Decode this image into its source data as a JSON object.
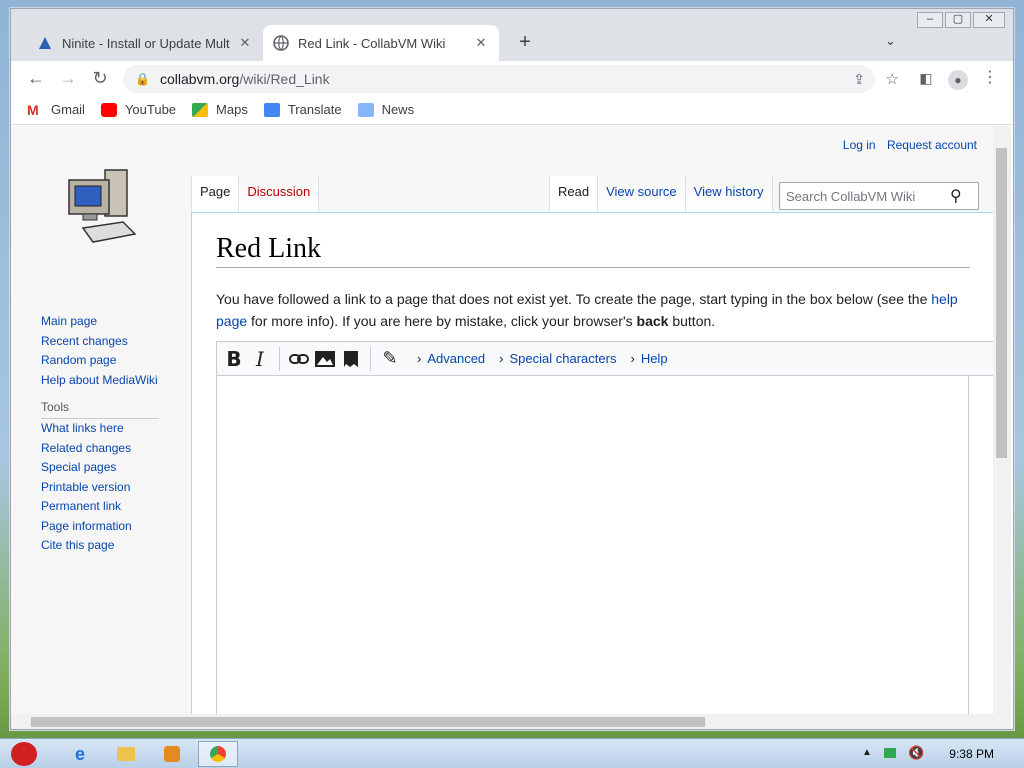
{
  "browser": {
    "tabs": [
      {
        "title": "Ninite - Install or Update Mult"
      },
      {
        "title": "Red Link - CollabVM Wiki"
      }
    ],
    "url_host": "collabvm.org",
    "url_path": "/wiki/Red_Link",
    "bookmarks": [
      "Gmail",
      "YouTube",
      "Maps",
      "Translate",
      "News"
    ]
  },
  "wiki": {
    "top_links": [
      "Log in",
      "Request account"
    ],
    "left_tabs": [
      "Page",
      "Discussion"
    ],
    "right_tabs": [
      "Read",
      "View source",
      "View history"
    ],
    "search_placeholder": "Search CollabVM Wiki",
    "title": "Red Link",
    "intro": {
      "part1": "You have followed a link to a page that does not exist yet. To create the page, start typing in the box below (see the ",
      "help_link": "help page",
      "part2": " for more info). If you are here by mistake, click your browser's ",
      "bold": "back",
      "part3": " button."
    },
    "nav_links": [
      "Main page",
      "Recent changes",
      "Random page",
      "Help about MediaWiki"
    ],
    "tools_heading": "Tools",
    "tools_links": [
      "What links here",
      "Related changes",
      "Special pages",
      "Printable version",
      "Permanent link",
      "Page information",
      "Cite this page"
    ],
    "editor_links": [
      "Advanced",
      "Special characters",
      "Help"
    ]
  },
  "taskbar": {
    "clock": "9:38 PM"
  },
  "colors": {
    "link": "#0645ad",
    "tab_bar": "#dee1e6"
  }
}
